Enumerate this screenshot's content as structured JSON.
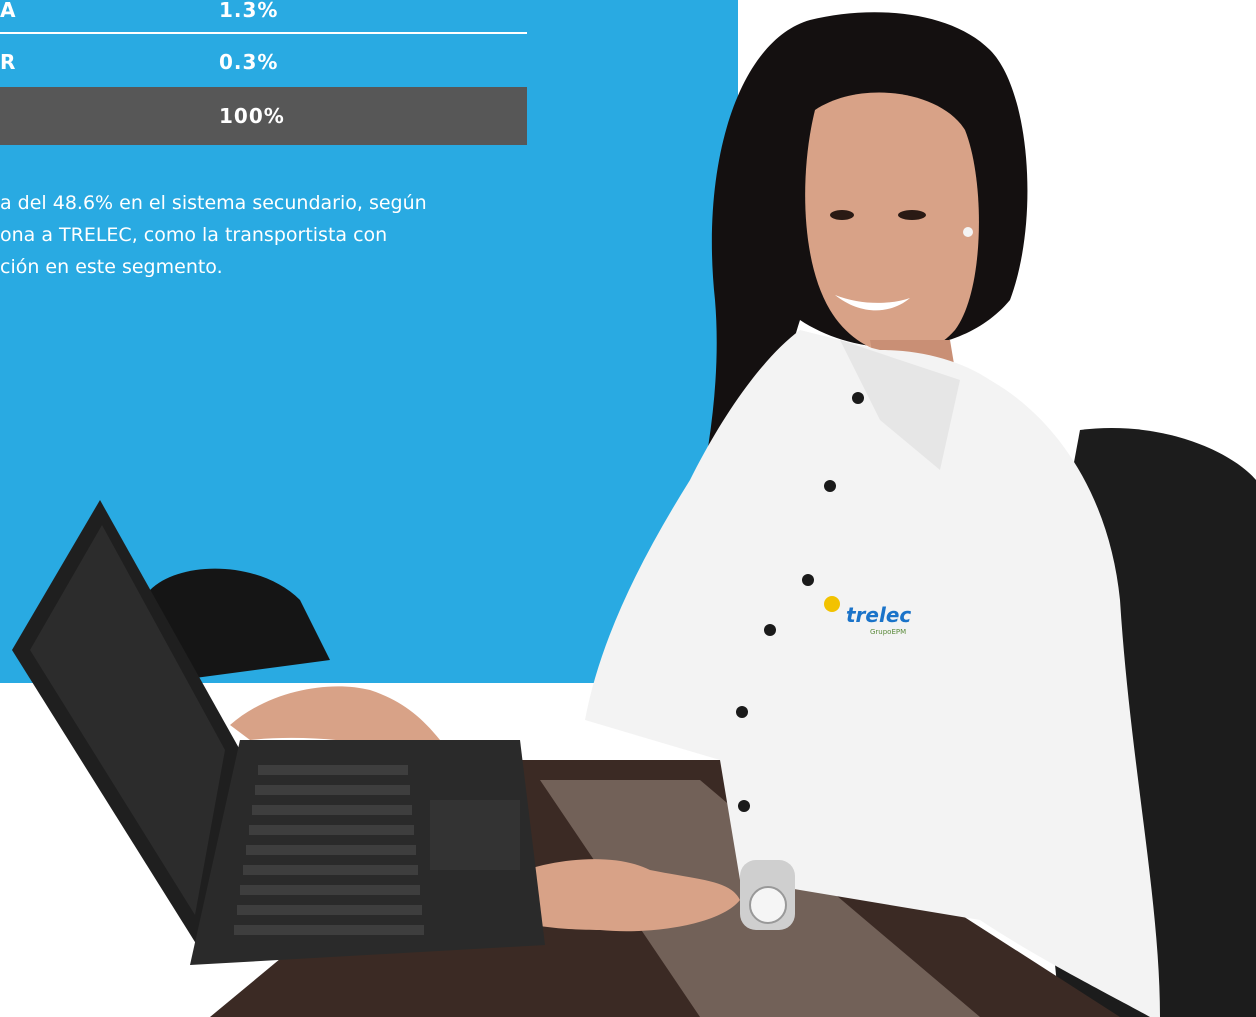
{
  "table": {
    "rows": [
      {
        "label": "A",
        "value": "1.3%"
      },
      {
        "label": "R",
        "value": "0.3%"
      }
    ],
    "total": {
      "value": "100%"
    }
  },
  "paragraph": {
    "lines": [
      "a del  48.6% en el sistema secundario, según",
      "ona a TRELEC,  como la transportista con",
      "ción en este segmento."
    ]
  },
  "photo": {
    "shirt_logo": "trelec",
    "shirt_logo_sub": "GrupoEPM"
  },
  "colors": {
    "panel_blue": "#29aae2",
    "total_row_gray": "#575757",
    "text": "#ffffff"
  }
}
